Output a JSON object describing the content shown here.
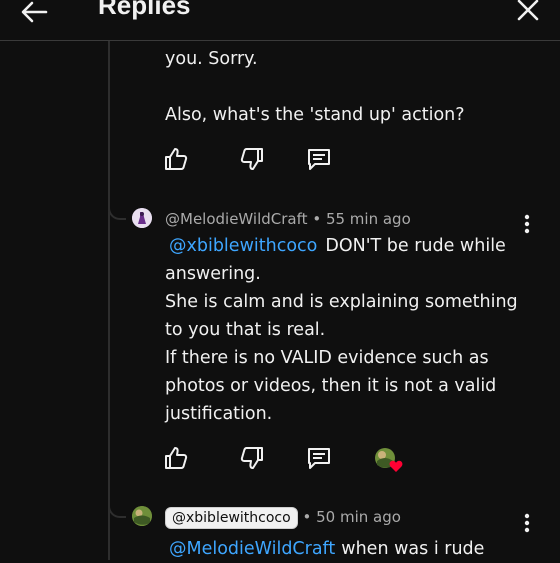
{
  "header": {
    "title": "Replies"
  },
  "comments": [
    {
      "lines": [
        "you. Sorry.",
        "",
        "Also, what's the 'stand up' action?"
      ]
    },
    {
      "author": "@MelodieWildCraft",
      "time": "55 min ago",
      "mention": "@xbiblewithcoco",
      "first_line_rest": "DON'T be rude while",
      "lines": [
        "answering.",
        "She is calm and is explaining something",
        "to you that is real.",
        "If there is no VALID evidence such as",
        "photos or videos, then it is not a valid",
        "justification."
      ]
    },
    {
      "author": "@xbiblewithcoco",
      "time": "50 min ago",
      "mention": "@MelodieWildCraft",
      "first_line_rest": "when was i rude"
    }
  ],
  "meta_separator": "•",
  "icons": {
    "back": "back-arrow-icon",
    "close": "close-icon",
    "like": "thumbs-up-icon",
    "dislike": "thumbs-down-icon",
    "reply": "reply-comment-icon",
    "more": "more-vertical-icon",
    "creator_heart": "creator-heart-icon"
  },
  "colors": {
    "background": "#0f0f0f",
    "text": "#f1f1f1",
    "muted": "#aaaaaa",
    "link": "#3ea6ff",
    "heart": "#ff0033"
  }
}
